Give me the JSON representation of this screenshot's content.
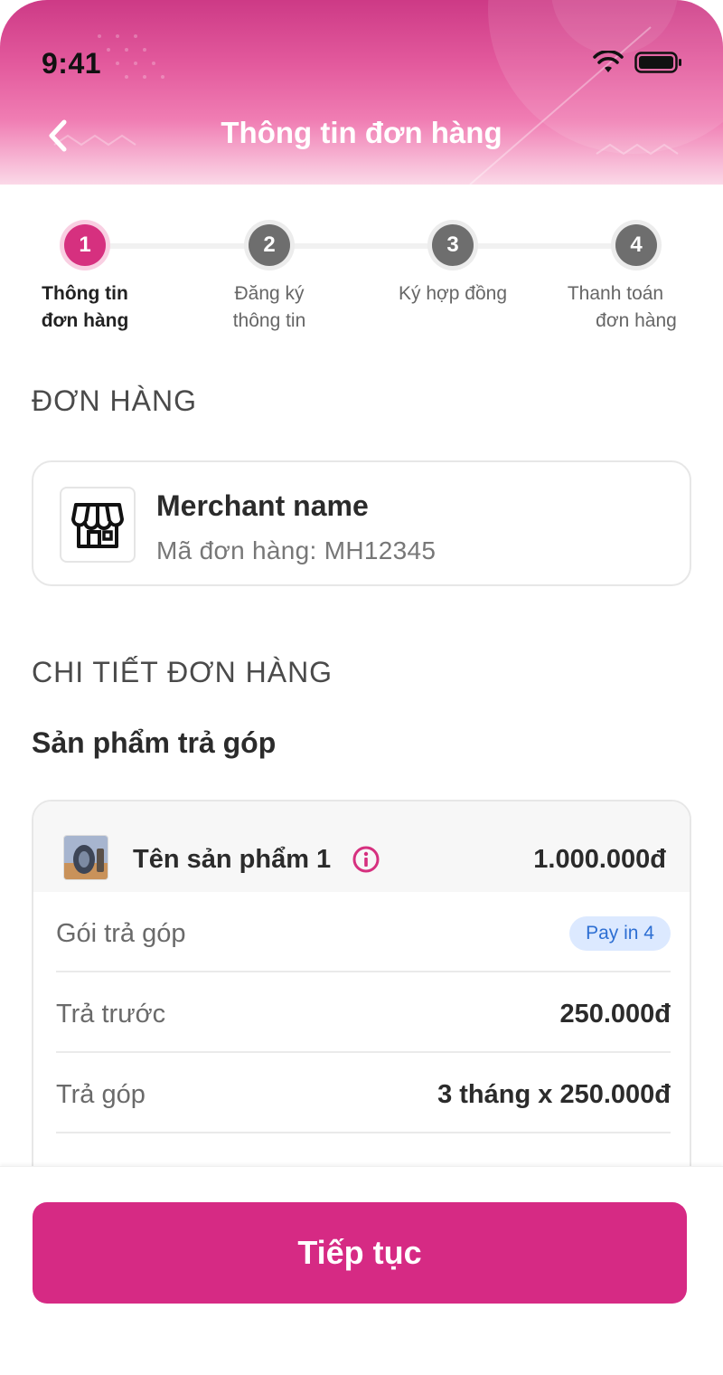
{
  "status_bar": {
    "time": "9:41"
  },
  "header": {
    "title": "Thông tin đơn hàng"
  },
  "stepper": {
    "steps": [
      {
        "number": "1",
        "label_line1": "Thông tin",
        "label_line2": "đơn hàng"
      },
      {
        "number": "2",
        "label_line1": "Đăng ký",
        "label_line2": "thông tin"
      },
      {
        "number": "3",
        "label_line1": "Ký hợp đồng",
        "label_line2": ""
      },
      {
        "number": "4",
        "label_line1": "Thanh toán",
        "label_line2": "đơn hàng"
      }
    ],
    "active_step": 1
  },
  "order_section": {
    "title": "ĐƠN HÀNG",
    "merchant_name": "Merchant name",
    "order_code": "Mã đơn hàng: MH12345"
  },
  "detail_section": {
    "title": "CHI TIẾT ĐƠN HÀNG",
    "subtitle": "Sản phẩm trả góp",
    "product": {
      "name": "Tên sản phẩm 1",
      "price": "1.000.000đ"
    },
    "rows": [
      {
        "label": "Gói trả góp",
        "value": "Pay in 4",
        "type": "badge"
      },
      {
        "label": "Trả trước",
        "value": "250.000đ",
        "type": "text"
      },
      {
        "label": "Trả góp",
        "value": "3 tháng x 250.000đ",
        "type": "text"
      }
    ]
  },
  "footer": {
    "cta_label": "Tiếp tục"
  },
  "colors": {
    "primary": "#d62a84",
    "header_gradient_start": "#cd3a86",
    "badge_bg": "#dce9ff",
    "badge_text": "#2e6fd3"
  }
}
